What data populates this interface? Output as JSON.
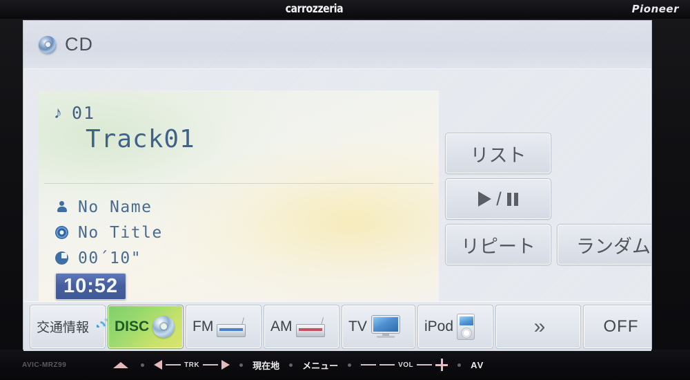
{
  "unit": {
    "brand_left": "carrozzeria",
    "brand_right": "Pioneer",
    "model": "AVIC-MRZ99",
    "hard_keys": {
      "eject": "eject-icon",
      "trk_label": "TRK",
      "current_location": "現在地",
      "menu": "メニュー",
      "vol_label": "VOL",
      "av": "AV"
    }
  },
  "screen": {
    "header": {
      "source_icon": "cd-disc-icon",
      "source_label": "CD"
    },
    "now_playing": {
      "note_icon": "music-note-icon",
      "track_number": "01",
      "track_title": "Track01",
      "meta": [
        {
          "icon": "person-icon",
          "label": "No Name"
        },
        {
          "icon": "disc-icon",
          "label": "No Title"
        },
        {
          "icon": "clock-icon",
          "label": "00´10\""
        }
      ],
      "clock": "10:52"
    },
    "controls": [
      {
        "name": "list-button",
        "label": "リスト"
      },
      {
        "name": "play-pause-button",
        "label": "▶/❚❚"
      },
      {
        "name": "repeat-button",
        "label": "リピート"
      },
      {
        "name": "random-button",
        "label": "ランダム"
      }
    ],
    "sources": [
      {
        "name": "traffic-info",
        "label": "交通情報",
        "icon": "broadcast-wave-icon",
        "active": false
      },
      {
        "name": "disc",
        "label": "DISC",
        "icon": "cd-disc-icon",
        "active": true
      },
      {
        "name": "fm",
        "label": "FM",
        "icon": "radio-tuner-icon",
        "active": false
      },
      {
        "name": "am",
        "label": "AM",
        "icon": "radio-tuner-icon",
        "active": false
      },
      {
        "name": "tv",
        "label": "TV",
        "icon": "television-icon",
        "active": false
      },
      {
        "name": "ipod",
        "label": "iPod",
        "icon": "ipod-device-icon",
        "active": false
      },
      {
        "name": "next-page",
        "label": "»",
        "icon": "double-chevron-right-icon",
        "active": false
      },
      {
        "name": "off",
        "label": "OFF",
        "icon": "",
        "active": false
      }
    ]
  },
  "colors": {
    "accent_active": "#9ad96e",
    "text_blue": "#4a6b90",
    "clock_bg": "#46609f",
    "screen_bg": "#e7eaf0"
  }
}
